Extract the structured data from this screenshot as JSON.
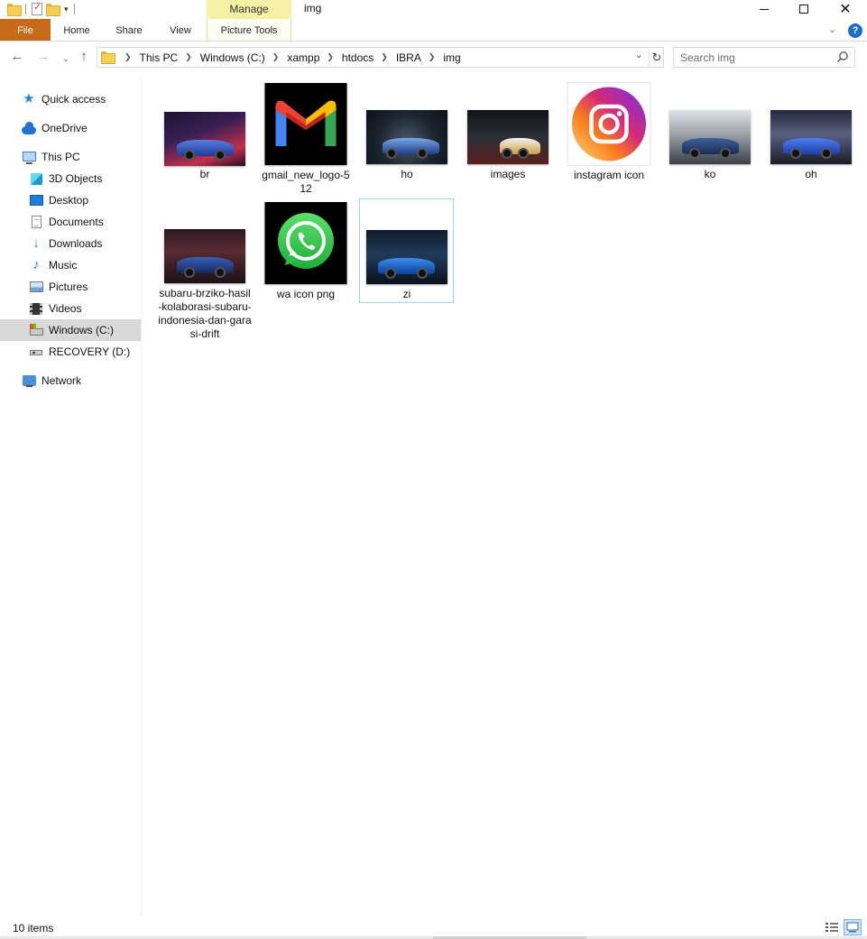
{
  "window": {
    "title": "img",
    "manage_label": "Manage",
    "controls": {
      "minimize": "minimize",
      "maximize": "maximize",
      "close": "close"
    }
  },
  "ribbon": {
    "tabs": [
      "File",
      "Home",
      "Share",
      "View",
      "Picture Tools"
    ],
    "file_color": "#c76b1a",
    "manage_color": "#f5f1a5"
  },
  "address": {
    "crumbs": [
      "This PC",
      "Windows (C:)",
      "xampp",
      "htdocs",
      "IBRA",
      "img"
    ]
  },
  "search": {
    "placeholder": "Search img"
  },
  "sidebar": {
    "items": [
      {
        "label": "Quick access",
        "icon": "star-icon"
      },
      {
        "label": "OneDrive",
        "icon": "cloud-icon"
      },
      {
        "label": "This PC",
        "icon": "computer-icon"
      },
      {
        "label": "3D Objects",
        "icon": "cube-icon"
      },
      {
        "label": "Desktop",
        "icon": "desktop-icon"
      },
      {
        "label": "Documents",
        "icon": "document-icon"
      },
      {
        "label": "Downloads",
        "icon": "download-icon"
      },
      {
        "label": "Music",
        "icon": "music-icon"
      },
      {
        "label": "Pictures",
        "icon": "pictures-icon"
      },
      {
        "label": "Videos",
        "icon": "videos-icon"
      },
      {
        "label": "Windows (C:)",
        "icon": "drive-icon",
        "selected": true
      },
      {
        "label": "RECOVERY (D:)",
        "icon": "drive-icon"
      },
      {
        "label": "Network",
        "icon": "network-icon"
      }
    ]
  },
  "files": [
    {
      "name": "br",
      "kind": "car-photo"
    },
    {
      "name": "gmail_new_logo-512",
      "kind": "gmail-logo"
    },
    {
      "name": "ho",
      "kind": "car-photo"
    },
    {
      "name": "images",
      "kind": "car-photo"
    },
    {
      "name": "instagram icon",
      "kind": "instagram-logo"
    },
    {
      "name": "ko",
      "kind": "car-photo"
    },
    {
      "name": "oh",
      "kind": "car-photo"
    },
    {
      "name": "subaru-brziko-hasil-kolaborasi-subaru-indonesia-dan-garasi-drift",
      "kind": "car-photo"
    },
    {
      "name": "wa icon png",
      "kind": "whatsapp-logo"
    },
    {
      "name": "zi",
      "kind": "car-photo",
      "selected": true
    }
  ],
  "status": {
    "item_count": "10 items"
  }
}
